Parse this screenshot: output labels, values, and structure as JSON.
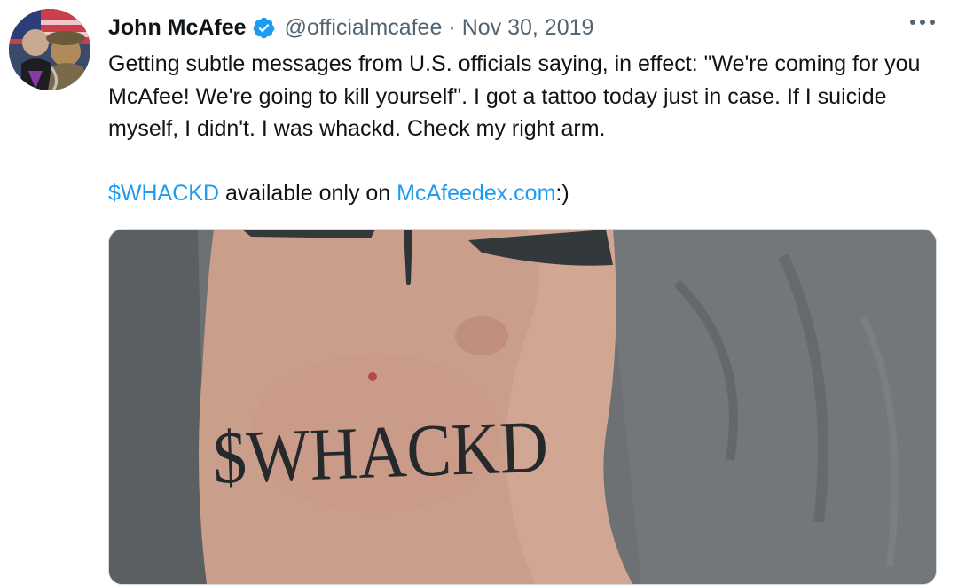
{
  "tweet": {
    "author": {
      "display_name": "John McAfee",
      "handle": "@officialmcafee",
      "verified": true
    },
    "separator": "·",
    "date": "Nov 30, 2019",
    "text": {
      "paragraph1": "Getting subtle messages from U.S. officials saying, in effect: \"We're coming for you McAfee! We're going to kill yourself\". I got a tattoo today just in case. If I suicide myself, I didn't. I was whackd. Check my right arm.",
      "cashtag": "$WHACKD",
      "middle": " available only on ",
      "url": "McAfeedex.com",
      "suffix": ":)"
    },
    "media": {
      "tattoo_text": "$WHACKD"
    },
    "icons": {
      "more": "more-horizontal-icon",
      "verified": "verified-badge-icon"
    },
    "colors": {
      "link": "#1d9bf0",
      "secondary_text": "#536471",
      "verified": "#1d9bf0"
    }
  }
}
